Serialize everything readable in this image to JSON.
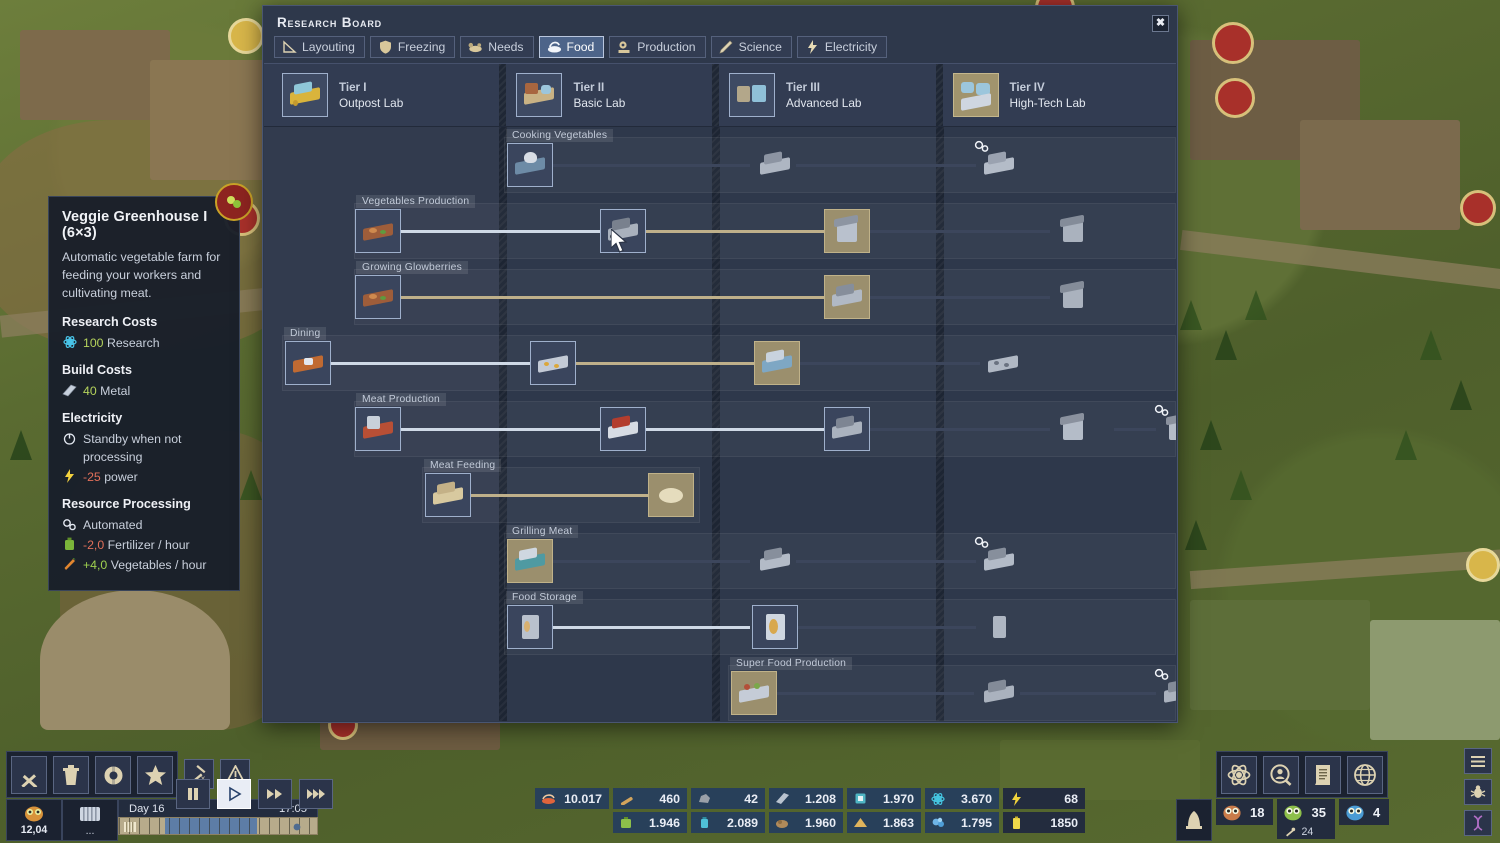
{
  "window": {
    "title": "Research Board",
    "close_label": "✖"
  },
  "tabs": [
    {
      "label": "Layouting",
      "icon": "ruler-icon",
      "active": false
    },
    {
      "label": "Freezing",
      "icon": "shield-icon",
      "active": false
    },
    {
      "label": "Needs",
      "icon": "needs-icon",
      "active": false
    },
    {
      "label": "Food",
      "icon": "food-icon",
      "active": true
    },
    {
      "label": "Production",
      "icon": "gears-icon",
      "active": false
    },
    {
      "label": "Science",
      "icon": "flask-icon",
      "active": false
    },
    {
      "label": "Electricity",
      "icon": "bolt-icon",
      "active": false
    }
  ],
  "tiers": [
    {
      "tier": "Tier I",
      "lab": "Outpost Lab",
      "highlight": false
    },
    {
      "tier": "Tier II",
      "lab": "Basic Lab",
      "highlight": false
    },
    {
      "tier": "Tier III",
      "lab": "Advanced Lab",
      "highlight": false
    },
    {
      "tier": "Tier IV",
      "lab": "High-Tech Lab",
      "highlight": true
    }
  ],
  "groups": [
    {
      "name": "Cooking Vegetables"
    },
    {
      "name": "Vegetables Production"
    },
    {
      "name": "Growing Glowberries"
    },
    {
      "name": "Dining"
    },
    {
      "name": "Meat Production"
    },
    {
      "name": "Meat Feeding"
    },
    {
      "name": "Grilling Meat"
    },
    {
      "name": "Food Storage"
    },
    {
      "name": "Super Food Production"
    }
  ],
  "tooltip": {
    "title": "Veggie Greenhouse I (6×3)",
    "description": "Automatic vegetable farm for feeding your workers and cultivating meat.",
    "research_costs_label": "Research Costs",
    "research_cost_value": "100",
    "research_cost_unit": "Research",
    "build_costs_label": "Build Costs",
    "build_cost_value": "40",
    "build_cost_unit": "Metal",
    "electricity_label": "Electricity",
    "electricity_mode": "Standby when not processing",
    "power_value": "-25",
    "power_unit": "power",
    "processing_label": "Resource Processing",
    "processing_mode": "Automated",
    "inputs": [
      {
        "value": "-2,0",
        "unit": "Fertilizer / hour",
        "sign": "neg",
        "icon": "fertilizer-icon"
      }
    ],
    "outputs": [
      {
        "value": "+4,0",
        "unit": "Vegetables / hour",
        "sign": "pos",
        "icon": "carrot-icon"
      }
    ]
  },
  "hud": {
    "left_tools": [
      {
        "icon": "tools-icon",
        "name": "build-tools"
      },
      {
        "icon": "trash-icon",
        "name": "demolish"
      },
      {
        "icon": "gear-icon",
        "name": "settings"
      },
      {
        "icon": "star-icon",
        "name": "favorites"
      }
    ],
    "left_small_tools": [
      {
        "icon": "priority-icon",
        "name": "priority"
      },
      {
        "icon": "warning-icon",
        "name": "alerts"
      }
    ],
    "speed_controls": [
      {
        "icon": "pause-icon",
        "name": "pause",
        "active": false
      },
      {
        "icon": "play-icon",
        "name": "play",
        "active": true
      },
      {
        "icon": "fast-forward-icon",
        "name": "speed-2x",
        "active": false
      },
      {
        "icon": "fast-forward-3-icon",
        "name": "speed-3x",
        "active": false
      }
    ],
    "temperature": "12,04",
    "storage_value": "...",
    "day_label": "Day 16",
    "clock": "17:05",
    "right_tools": [
      {
        "icon": "research-icon",
        "name": "research"
      },
      {
        "icon": "population-search-icon",
        "name": "inhabitants"
      },
      {
        "icon": "reports-icon",
        "name": "reports"
      },
      {
        "icon": "globe-icon",
        "name": "world-map"
      }
    ],
    "right_side_tools": [
      {
        "icon": "menu-icon",
        "name": "main-menu"
      },
      {
        "icon": "bug-icon",
        "name": "report-bug"
      },
      {
        "icon": "dna-icon",
        "name": "mutations"
      }
    ],
    "alarm_icon": "alarm-icon",
    "populations": [
      {
        "icon": "worker-icon",
        "count": "18",
        "color": "#c97b4a"
      },
      {
        "icon": "citizen-icon",
        "count": "35",
        "color": "#8dbf4a",
        "sub_icon": "tool-icon",
        "sub_count": "24"
      },
      {
        "icon": "child-icon",
        "count": "4",
        "color": "#4a9bd4"
      }
    ]
  },
  "resources": {
    "row1": [
      {
        "icon": "food-icon",
        "value": "10.017",
        "accent": "#e0643c"
      },
      {
        "icon": "wood-icon",
        "value": "460",
        "accent": "#d3a45c"
      },
      {
        "icon": "stone-icon",
        "value": "42",
        "accent": "#9aa0a8"
      },
      {
        "icon": "metal-icon",
        "value": "1.208",
        "accent": "#b9c3cf"
      },
      {
        "icon": "component-icon",
        "value": "1.970",
        "accent": "#4fb6c4"
      },
      {
        "icon": "research-icon",
        "value": "3.670",
        "accent": "#45c5e0"
      },
      {
        "icon": "power-icon",
        "value": "68",
        "accent": "#f2d33c"
      }
    ],
    "row2": [
      {
        "icon": "blank",
        "value": "",
        "accent": "transparent"
      },
      {
        "icon": "fertilizer-icon",
        "value": "1.946",
        "accent": "#8dbf4a"
      },
      {
        "icon": "water-icon",
        "value": "2.089",
        "accent": "#4fc0d8"
      },
      {
        "icon": "coal-icon",
        "value": "1.960",
        "accent": "#b08a5a"
      },
      {
        "icon": "sand-icon",
        "value": "1.863",
        "accent": "#e0b45c"
      },
      {
        "icon": "crystal-icon",
        "value": "1.795",
        "accent": "#6fb4e6"
      },
      {
        "icon": "battery-icon",
        "value": "1850",
        "accent": "#f0d84a"
      }
    ]
  }
}
